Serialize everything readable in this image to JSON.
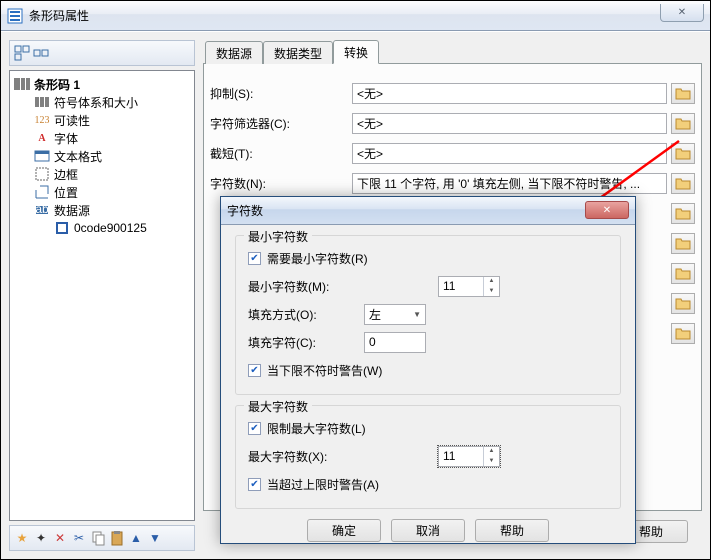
{
  "window": {
    "title": "条形码属性"
  },
  "tree": {
    "root": "条形码 1",
    "items": [
      "符号体系和大小",
      "可读性",
      "字体",
      "文本格式",
      "边框",
      "位置",
      "数据源"
    ],
    "data_item": "0code900125"
  },
  "tabs": {
    "t0": "数据源",
    "t1": "数据类型",
    "t2": "转换"
  },
  "form": {
    "suppress_label": "抑制(S):",
    "suppress_value": "<无>",
    "filter_label": "字符筛选器(C):",
    "filter_value": "<无>",
    "truncate_label": "截短(T):",
    "truncate_value": "<无>",
    "count_label": "字符数(N):",
    "count_value": "下限 11 个字符, 用 '0' 填充左侧, 当下限不符时警告, ..."
  },
  "dialog": {
    "title": "字符数",
    "min_group": "最小字符数",
    "need_min_label": "需要最小字符数(R)",
    "min_count_label": "最小字符数(M):",
    "min_count_value": "11",
    "fill_method_label": "填充方式(O):",
    "fill_method_value": "左",
    "fill_char_label": "填充字符(C):",
    "fill_char_value": "0",
    "warn_min_label": "当下限不符时警告(W)",
    "max_group": "最大字符数",
    "limit_max_label": "限制最大字符数(L)",
    "max_count_label": "最大字符数(X):",
    "max_count_value": "11",
    "warn_max_label": "当超过上限时警告(A)",
    "ok": "确定",
    "cancel": "取消",
    "help": "帮助"
  },
  "buttons": {
    "close": "关闭",
    "help": "帮助"
  }
}
